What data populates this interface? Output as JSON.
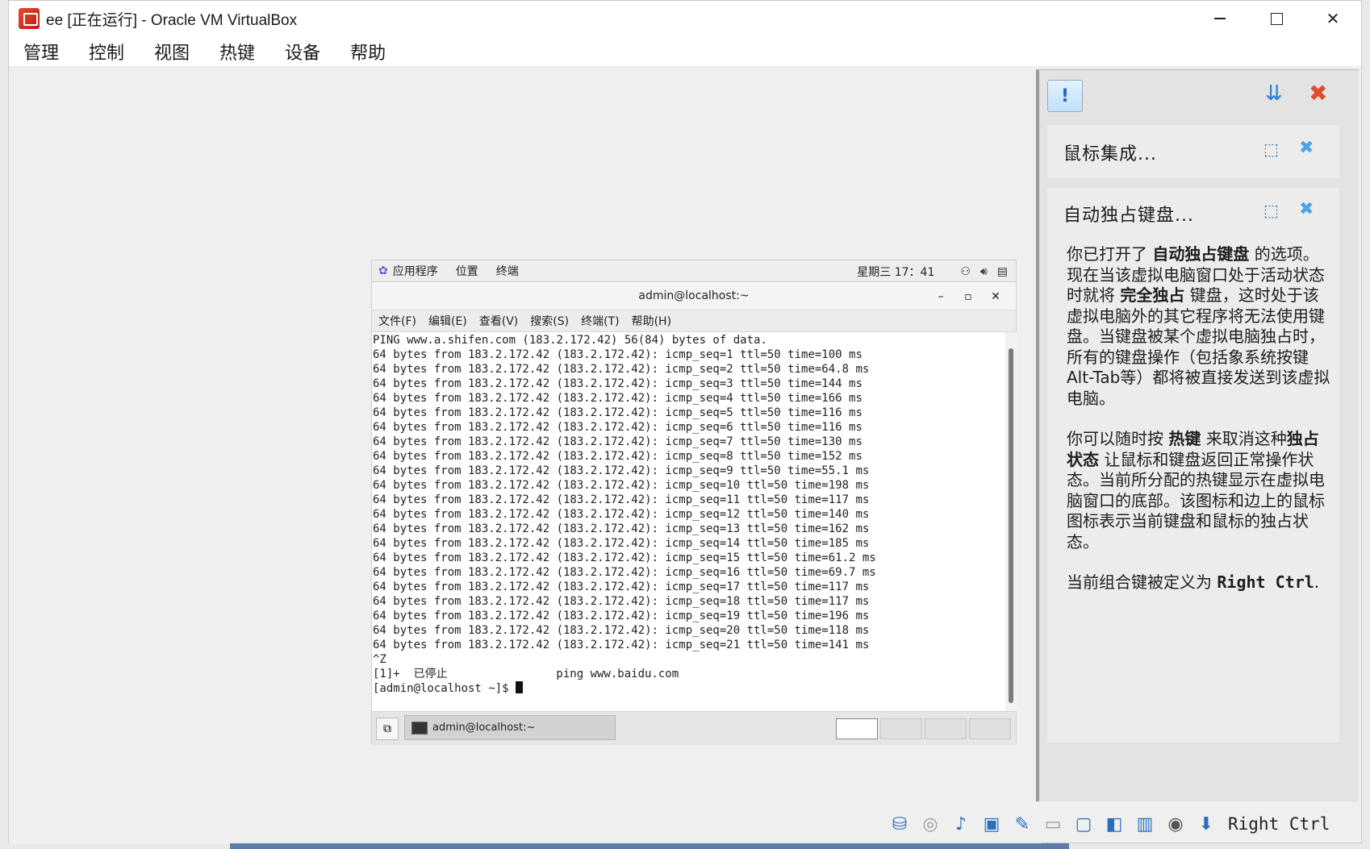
{
  "window": {
    "title": "ee [正在运行] - Oracle VM VirtualBox"
  },
  "menubar": {
    "items": [
      "管理",
      "控制",
      "视图",
      "热键",
      "设备",
      "帮助"
    ]
  },
  "guest": {
    "topbar": {
      "apps": "应用程序",
      "places": "位置",
      "terminal": "终端",
      "clock": "星期三 17：41"
    },
    "terminal_title": "admin@localhost:~",
    "terminal_menu": [
      "文件(F)",
      "编辑(E)",
      "查看(V)",
      "搜索(S)",
      "终端(T)",
      "帮助(H)"
    ],
    "lines": [
      "PING www.a.shifen.com (183.2.172.42) 56(84) bytes of data.",
      "64 bytes from 183.2.172.42 (183.2.172.42): icmp_seq=1 ttl=50 time=100 ms",
      "64 bytes from 183.2.172.42 (183.2.172.42): icmp_seq=2 ttl=50 time=64.8 ms",
      "64 bytes from 183.2.172.42 (183.2.172.42): icmp_seq=3 ttl=50 time=144 ms",
      "64 bytes from 183.2.172.42 (183.2.172.42): icmp_seq=4 ttl=50 time=166 ms",
      "64 bytes from 183.2.172.42 (183.2.172.42): icmp_seq=5 ttl=50 time=116 ms",
      "64 bytes from 183.2.172.42 (183.2.172.42): icmp_seq=6 ttl=50 time=116 ms",
      "64 bytes from 183.2.172.42 (183.2.172.42): icmp_seq=7 ttl=50 time=130 ms",
      "64 bytes from 183.2.172.42 (183.2.172.42): icmp_seq=8 ttl=50 time=152 ms",
      "64 bytes from 183.2.172.42 (183.2.172.42): icmp_seq=9 ttl=50 time=55.1 ms",
      "64 bytes from 183.2.172.42 (183.2.172.42): icmp_seq=10 ttl=50 time=198 ms",
      "64 bytes from 183.2.172.42 (183.2.172.42): icmp_seq=11 ttl=50 time=117 ms",
      "64 bytes from 183.2.172.42 (183.2.172.42): icmp_seq=12 ttl=50 time=140 ms",
      "64 bytes from 183.2.172.42 (183.2.172.42): icmp_seq=13 ttl=50 time=162 ms",
      "64 bytes from 183.2.172.42 (183.2.172.42): icmp_seq=14 ttl=50 time=185 ms",
      "64 bytes from 183.2.172.42 (183.2.172.42): icmp_seq=15 ttl=50 time=61.2 ms",
      "64 bytes from 183.2.172.42 (183.2.172.42): icmp_seq=16 ttl=50 time=69.7 ms",
      "64 bytes from 183.2.172.42 (183.2.172.42): icmp_seq=17 ttl=50 time=117 ms",
      "64 bytes from 183.2.172.42 (183.2.172.42): icmp_seq=18 ttl=50 time=117 ms",
      "64 bytes from 183.2.172.42 (183.2.172.42): icmp_seq=19 ttl=50 time=196 ms",
      "64 bytes from 183.2.172.42 (183.2.172.42): icmp_seq=20 ttl=50 time=118 ms",
      "64 bytes from 183.2.172.42 (183.2.172.42): icmp_seq=21 ttl=50 time=141 ms",
      "^Z",
      "[1]+  已停止                ping www.baidu.com"
    ],
    "prompt": "[admin@localhost ~]$ ",
    "taskbar_item": "admin@localhost:~"
  },
  "notifications": {
    "card1_title": "鼠标集成...",
    "card2_title": "自动独占键盘...",
    "p1": [
      "你已打开了 ",
      "自动独占键盘",
      " 的选项。现在当该虚拟电脑窗口处于活动状态时就将 ",
      "完全独占",
      " 键盘，这时处于该虚拟电脑外的其它程序将无法使用键盘。当键盘被某个虚拟电脑独占时，所有的键盘操作（包括象系统按键Alt-Tab等）都将被直接发送到该虚拟电脑。"
    ],
    "p2": [
      "你可以随时按 ",
      "热键",
      " 来取消这种",
      "独占状态",
      " 让鼠标和键盘返回正常操作状态。当前所分配的热键显示在虚拟电脑窗口的底部。该图标和边上的鼠标图标表示当前键盘和鼠标的独占状态。"
    ],
    "p3": [
      "当前组合键被定义为 ",
      "Right Ctrl",
      "."
    ]
  },
  "statusbar": {
    "hotkey": "Right Ctrl"
  },
  "icons": [
    "app-logo",
    "minimize",
    "maximize",
    "close",
    "gnome-apps",
    "network",
    "volume",
    "battery",
    "alert",
    "sort",
    "close-all",
    "mouse",
    "keyboard",
    "hdd",
    "cd",
    "audio",
    "network-adapter",
    "usb",
    "shared-folder",
    "display",
    "video-capture",
    "cpu",
    "mouse-capture",
    "keyboard-capture"
  ]
}
